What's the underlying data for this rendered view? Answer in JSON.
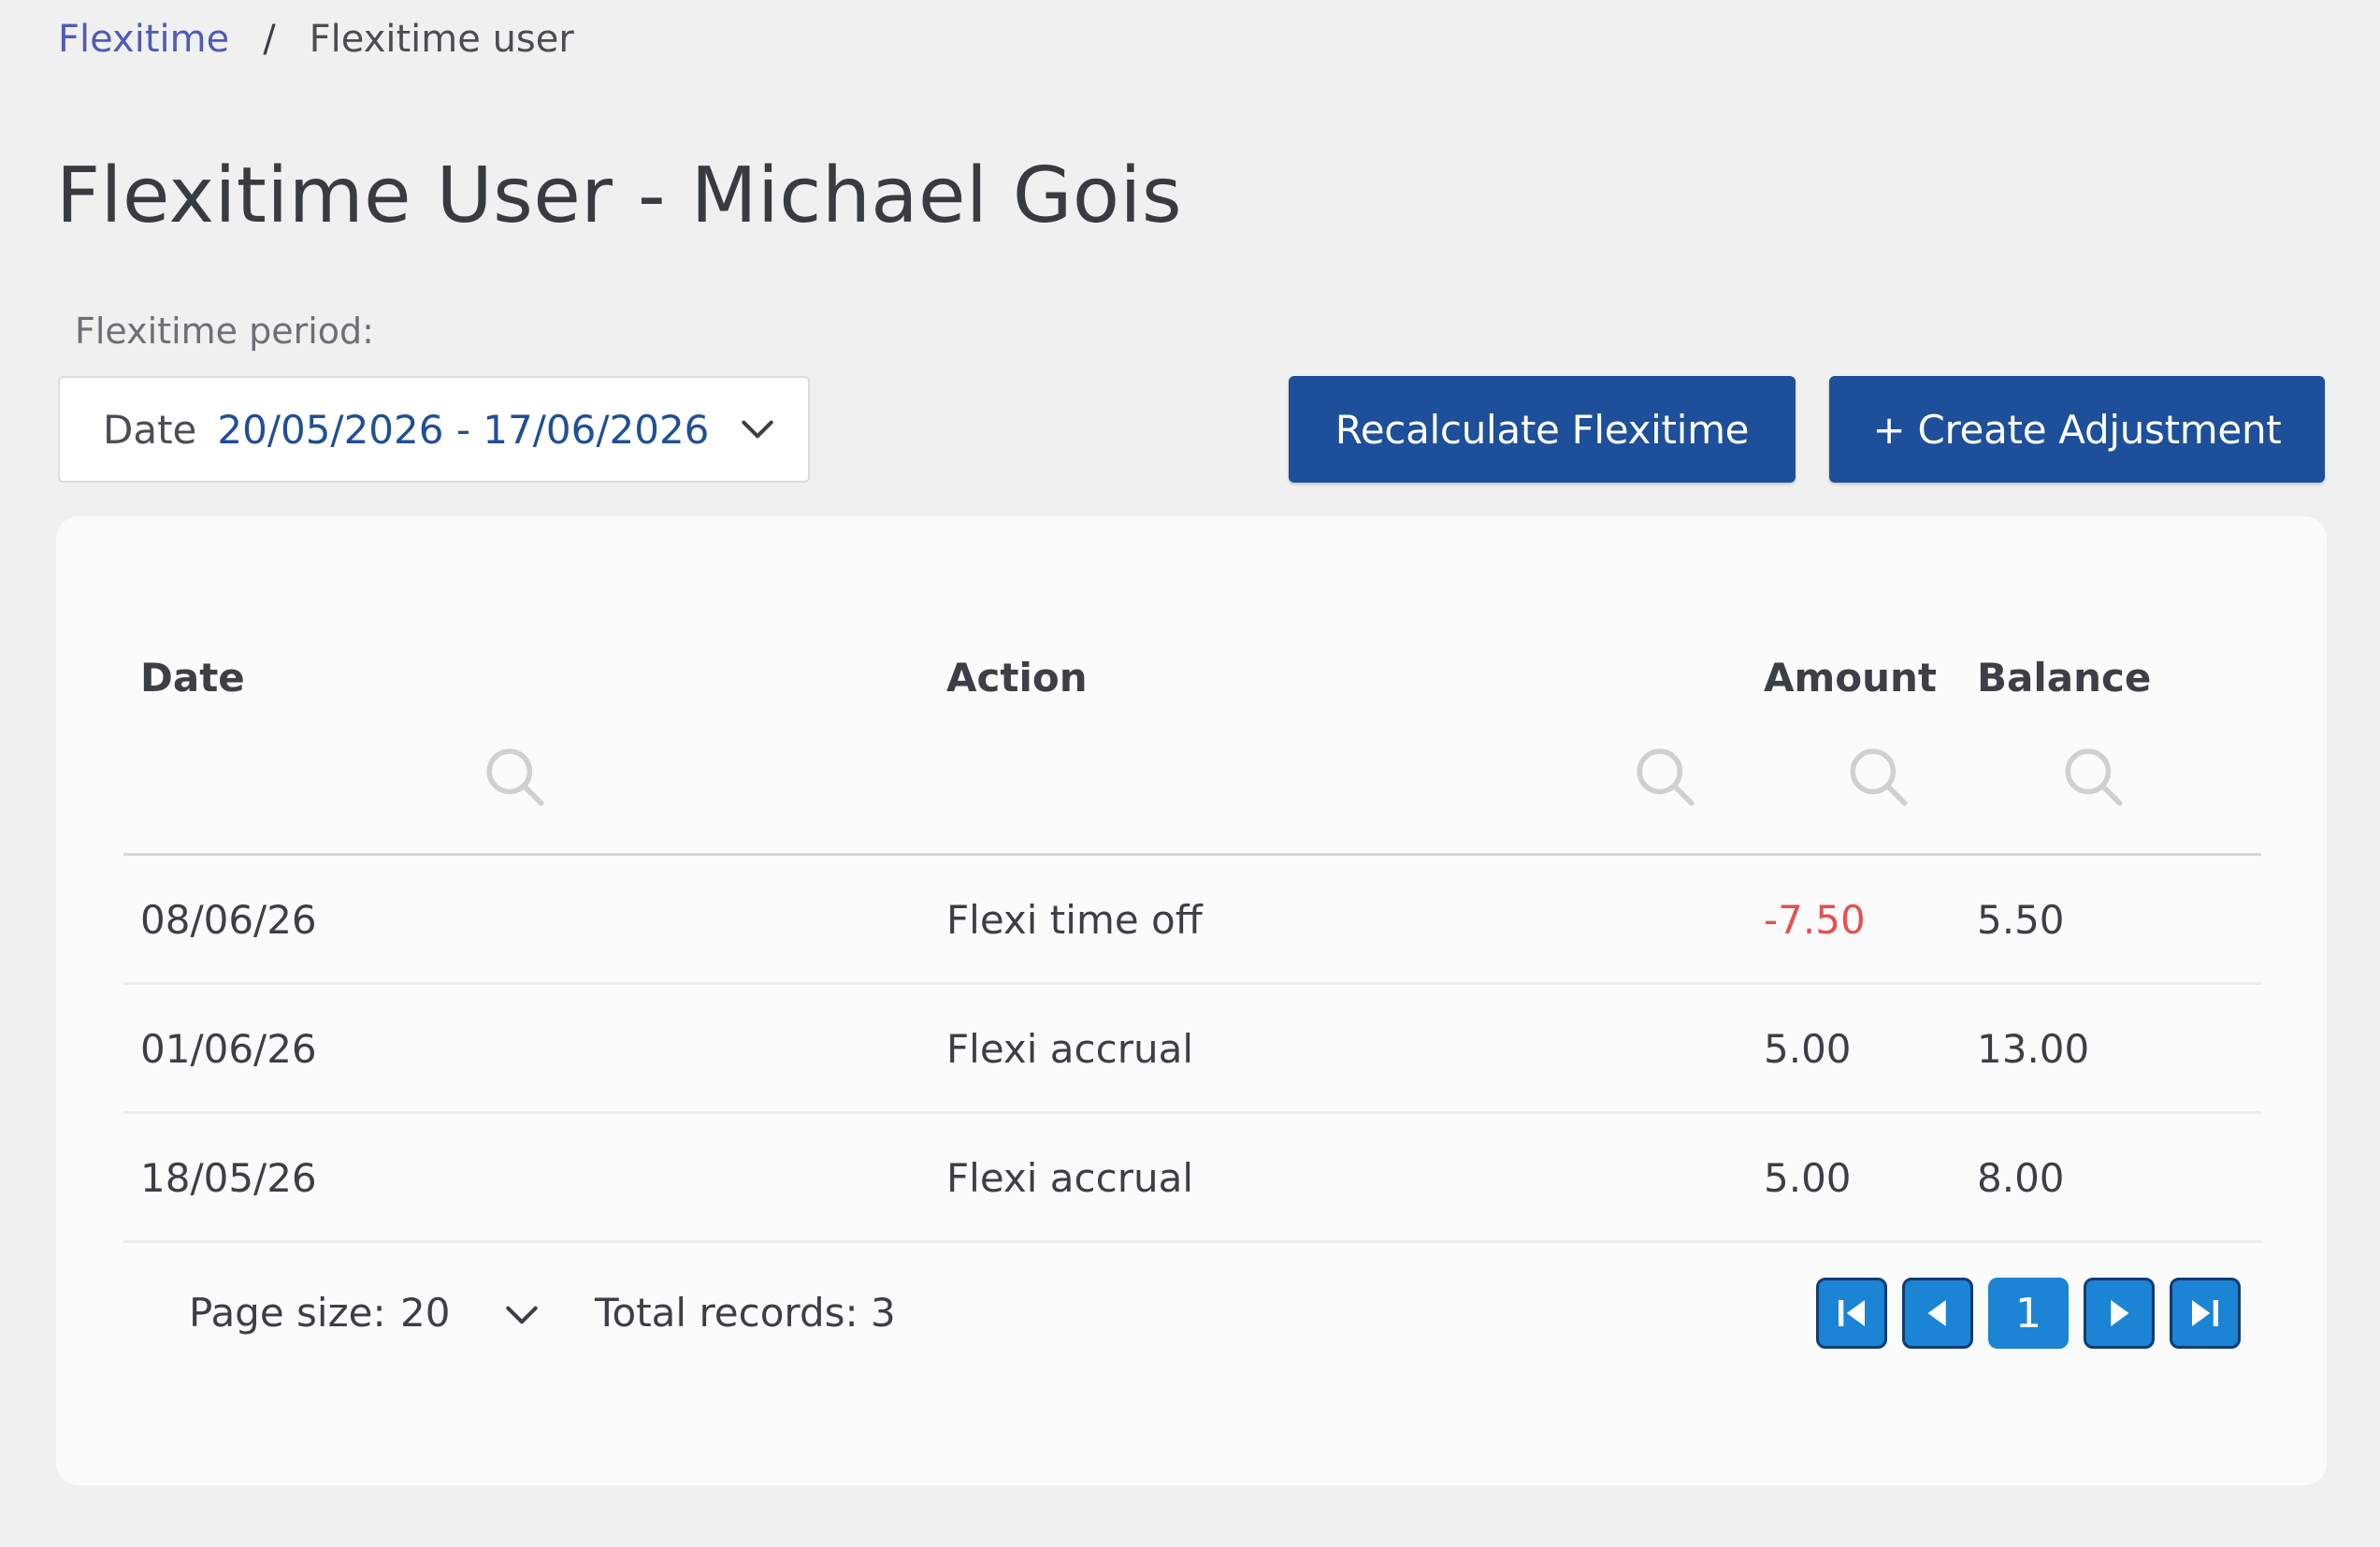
{
  "breadcrumb": {
    "root": "Flexitime",
    "separator": "/",
    "current": "Flexitime user"
  },
  "page_title": "Flexitime User - Michael Gois",
  "period": {
    "label": "Flexitime period:",
    "prefix": "Date",
    "value": "20/05/2026 - 17/06/2026"
  },
  "buttons": {
    "recalculate": "Recalculate Flexitime",
    "create_adjustment": "+ Create Adjustment"
  },
  "table": {
    "columns": {
      "date": "Date",
      "action": "Action",
      "amount": "Amount",
      "balance": "Balance"
    },
    "rows": [
      {
        "date": "08/06/26",
        "action": "Flexi time off",
        "amount": "-7.50",
        "balance": "5.50"
      },
      {
        "date": "01/06/26",
        "action": "Flexi accrual",
        "amount": "5.00",
        "balance": "13.00"
      },
      {
        "date": "18/05/26",
        "action": "Flexi accrual",
        "amount": "5.00",
        "balance": "8.00"
      }
    ]
  },
  "pager": {
    "page_size_label": "Page size:",
    "page_size": "20",
    "total_records": "Total records: 3",
    "current_page": "1"
  },
  "colors": {
    "primary_button": "#1d4f9a",
    "pager_button": "#1b84d4",
    "negative_amount": "#e65050",
    "link": "#4f5cb5"
  }
}
